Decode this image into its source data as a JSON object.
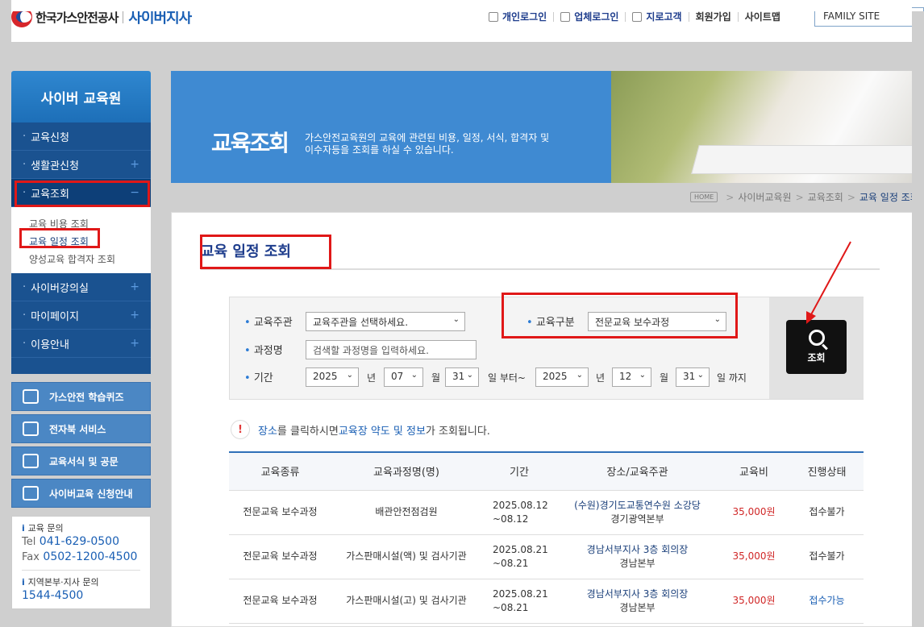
{
  "header": {
    "logo_name": "한국가스안전공사",
    "logo_sub": "사이버지사",
    "nav": [
      "개인로그인",
      "업체로그인",
      "지로고객",
      "회원가입",
      "사이트맵"
    ],
    "family_site": "FAMILY SITE"
  },
  "sidebar": {
    "title": "사이버 교육원",
    "items": [
      {
        "label": "교육신청",
        "plus": ""
      },
      {
        "label": "생활관신청",
        "plus": "+"
      },
      {
        "label": "교육조회",
        "plus": "−"
      },
      {
        "label": "사이버강의실",
        "plus": "+"
      },
      {
        "label": "마이페이지",
        "plus": "+"
      },
      {
        "label": "이용안내",
        "plus": "+"
      }
    ],
    "sub_items": [
      "교육 비용 조회",
      "교육 일정 조회",
      "양성교육 합격자 조회"
    ],
    "quick": [
      "가스안전 학습퀴즈",
      "전자북 서비스",
      "교육서식 및 공문",
      "사이버교육 신청안내"
    ],
    "contact": {
      "edu_label": "교육 문의",
      "tel_pre": "Tel",
      "tel": "041-629-0500",
      "fax_pre": "Fax",
      "fax": "0502-1200-4500",
      "branch_label": "지역본부·지사 문의",
      "branch_tel": "1544-4500"
    }
  },
  "banner": {
    "title": "교육조회",
    "desc": "가스안전교육원의 교육에 관련된 비용, 일정, 서식, 합격자 및 이수자등을 조회를 하실 수 있습니다."
  },
  "breadcrumb": {
    "home": "HOME",
    "items": [
      "사이버교육원",
      "교육조회",
      "교육 일정 조회"
    ],
    "sep": ">"
  },
  "page": {
    "title": "교육 일정 조회"
  },
  "search": {
    "org_label": "교육주관",
    "org_value": "교육주관을 선택하세요.",
    "type_label": "교육구분",
    "type_value": "전문교육 보수과정",
    "course_label": "과정명",
    "course_placeholder": "검색할 과정명을 입력하세요.",
    "period_label": "기간",
    "start_year": "2025",
    "start_month": "07",
    "start_day": "31",
    "end_year": "2025",
    "end_month": "12",
    "end_day": "31",
    "unit_year": "년",
    "unit_month": "월",
    "unit_day_from": "일 부터~",
    "unit_day_to": "일 까지",
    "button": "조회"
  },
  "notice": {
    "icon": "!",
    "part1": "장소",
    "part2": "를 클릭하시면 ",
    "part3": "교육장 약도 및 정보",
    "part4": "가 조회됩니다."
  },
  "table": {
    "headers": [
      "교육종류",
      "교육과정명(명)",
      "기간",
      "장소/교육주관",
      "교육비",
      "진행상태"
    ],
    "rows": [
      {
        "type": "전문교육 보수과정",
        "course": "배관안전점검원",
        "date1": "2025.08.12",
        "date2": "~08.12",
        "place": "(수원)경기도교통연수원 소강당",
        "org": "경기광역본부",
        "fee": "35,000원",
        "status": "접수불가",
        "ok": false
      },
      {
        "type": "전문교육 보수과정",
        "course": "가스판매시설(액) 및 검사기관",
        "date1": "2025.08.21",
        "date2": "~08.21",
        "place": "경남서부지사 3층 회의장",
        "org": "경남본부",
        "fee": "35,000원",
        "status": "접수불가",
        "ok": false
      },
      {
        "type": "전문교육 보수과정",
        "course": "가스판매시설(고) 및 검사기관",
        "date1": "2025.08.21",
        "date2": "~08.21",
        "place": "경남서부지사 3층 회의장",
        "org": "경남본부",
        "fee": "35,000원",
        "status": "접수가능",
        "ok": true
      }
    ]
  },
  "colors": {
    "accent": "#1a5fb4",
    "highlight": "#e01818",
    "price": "#d02727"
  }
}
